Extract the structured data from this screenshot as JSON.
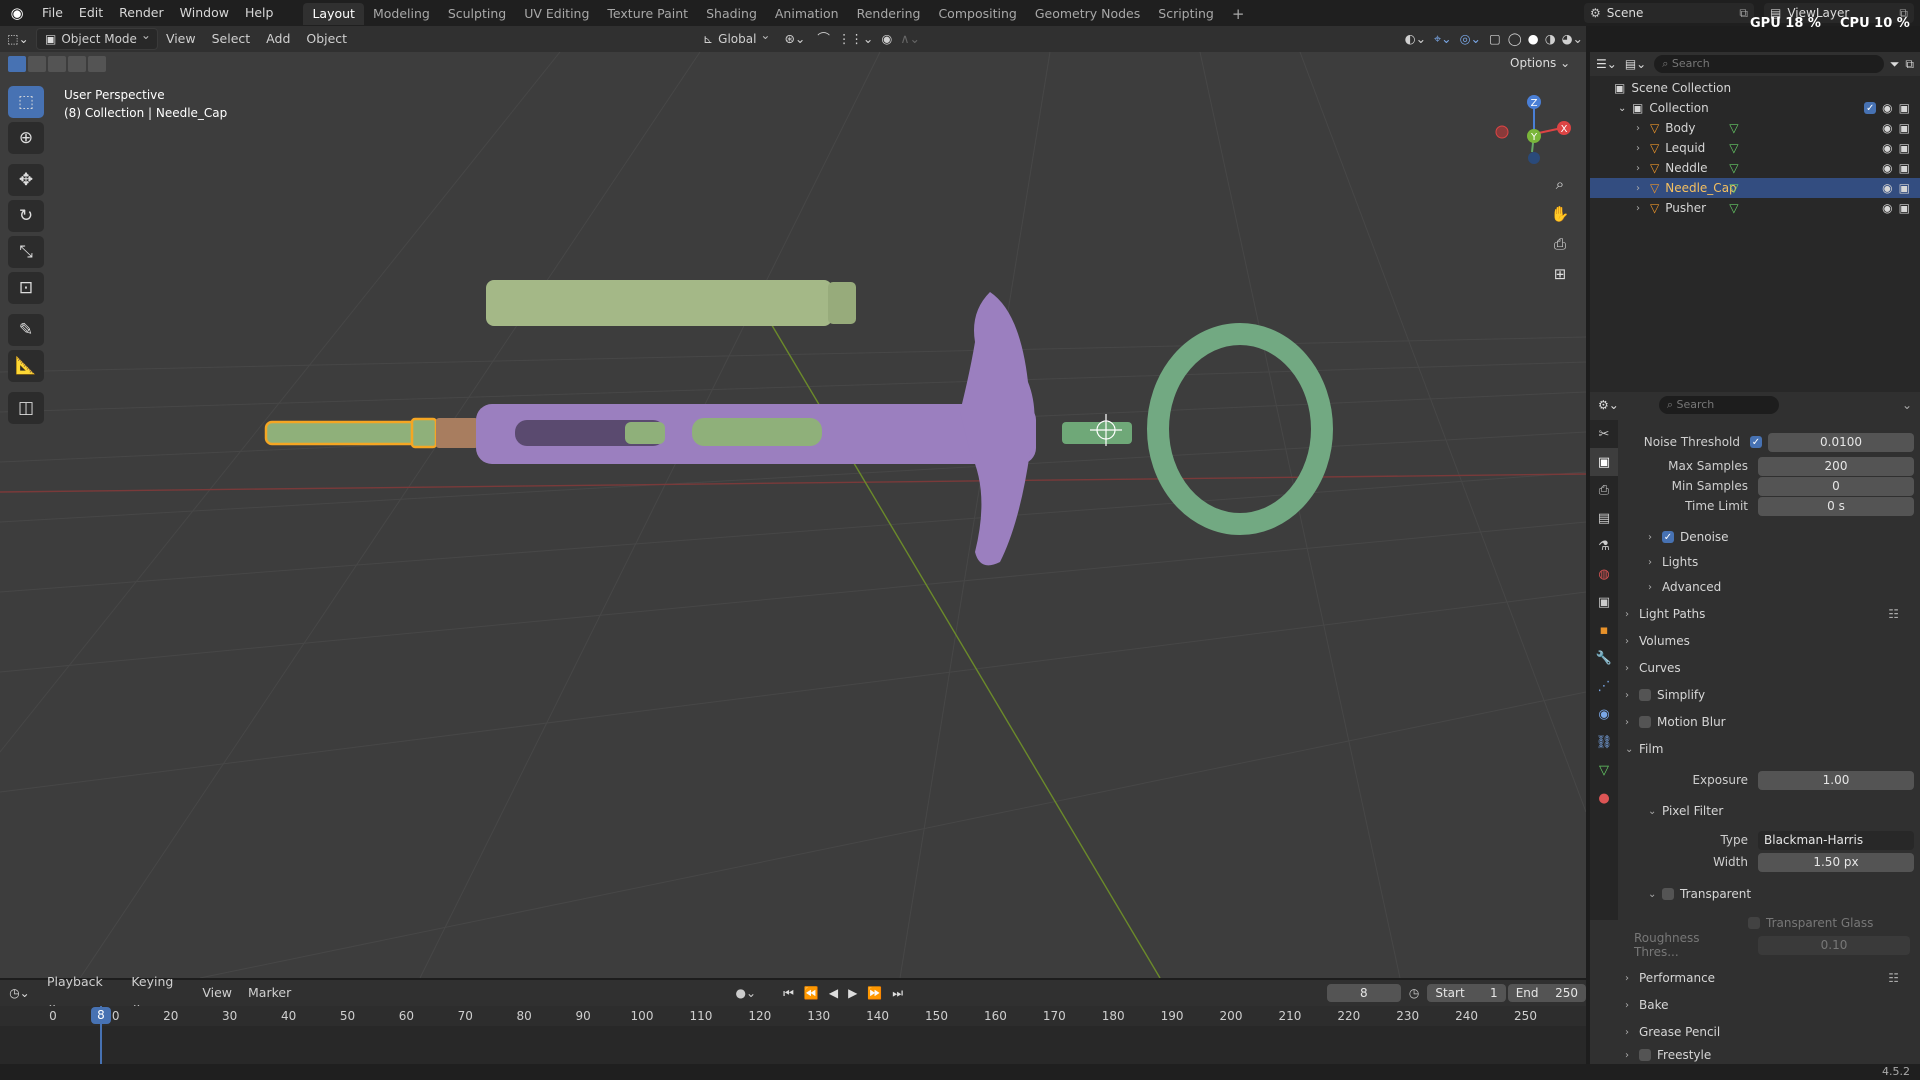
{
  "topbar": {
    "menus": [
      "File",
      "Edit",
      "Render",
      "Window",
      "Help"
    ],
    "workspaces": [
      "Layout",
      "Modeling",
      "Sculpting",
      "UV Editing",
      "Texture Paint",
      "Shading",
      "Animation",
      "Rendering",
      "Compositing",
      "Geometry Nodes",
      "Scripting"
    ],
    "active_workspace": "Layout",
    "scene": "Scene",
    "view_layer": "ViewLayer",
    "gpu_label": "GPU",
    "gpu_value": "18 %",
    "cpu_label": "CPU",
    "cpu_value": "10 %"
  },
  "viewport_header": {
    "mode": "Object Mode",
    "menus": [
      "View",
      "Select",
      "Add",
      "Object"
    ],
    "orientation": "Global",
    "options": "Options"
  },
  "viewport": {
    "perspective": "User Perspective",
    "context": "(8) Collection | Needle_Cap",
    "gizmo_axes": [
      "Z",
      "Y",
      "X"
    ]
  },
  "outliner": {
    "search_placeholder": "Search",
    "scene_collection": "Scene Collection",
    "collection": "Collection",
    "items": [
      {
        "name": "Body",
        "selected": false
      },
      {
        "name": "Lequid",
        "selected": false
      },
      {
        "name": "Neddle",
        "selected": false
      },
      {
        "name": "Needle_Cap",
        "selected": true
      },
      {
        "name": "Pusher",
        "selected": false
      }
    ]
  },
  "properties": {
    "search_placeholder": "Search",
    "noise_threshold": {
      "label": "Noise Threshold",
      "value": "0.0100"
    },
    "max_samples": {
      "label": "Max Samples",
      "value": "200"
    },
    "min_samples": {
      "label": "Min Samples",
      "value": "0"
    },
    "time_limit": {
      "label": "Time Limit",
      "value": "0 s"
    },
    "sub_panels": [
      "Denoise",
      "Lights",
      "Advanced"
    ],
    "panels_top": [
      "Light Paths",
      "Volumes",
      "Curves",
      "Simplify",
      "Motion Blur"
    ],
    "film": "Film",
    "exposure": {
      "label": "Exposure",
      "value": "1.00"
    },
    "pixel_filter": "Pixel Filter",
    "filter_type": {
      "label": "Type",
      "value": "Blackman-Harris"
    },
    "filter_width": {
      "label": "Width",
      "value": "1.50 px"
    },
    "transparent": "Transparent",
    "transparent_glass": "Transparent Glass",
    "roughness": {
      "label": "Roughness Thres...",
      "value": "0.10"
    },
    "panels_bottom": [
      "Performance",
      "Bake",
      "Grease Pencil",
      "Freestyle"
    ]
  },
  "timeline": {
    "menus": [
      "Playback",
      "Keying",
      "View",
      "Marker"
    ],
    "current_frame": "8",
    "start_label": "Start",
    "start": "1",
    "end_label": "End",
    "end": "250",
    "ticks": [
      "0",
      "10",
      "20",
      "30",
      "40",
      "50",
      "60",
      "70",
      "80",
      "90",
      "100",
      "110",
      "120",
      "130",
      "140",
      "150",
      "160",
      "170",
      "180",
      "190",
      "200",
      "210",
      "220",
      "230",
      "240",
      "250"
    ]
  },
  "status": {
    "version": "4.5.2"
  },
  "colors": {
    "accent": "#4772b3",
    "selection_orange": "#f5a623",
    "object_green": "#8fb07a",
    "object_purple": "#9b7fbf"
  }
}
